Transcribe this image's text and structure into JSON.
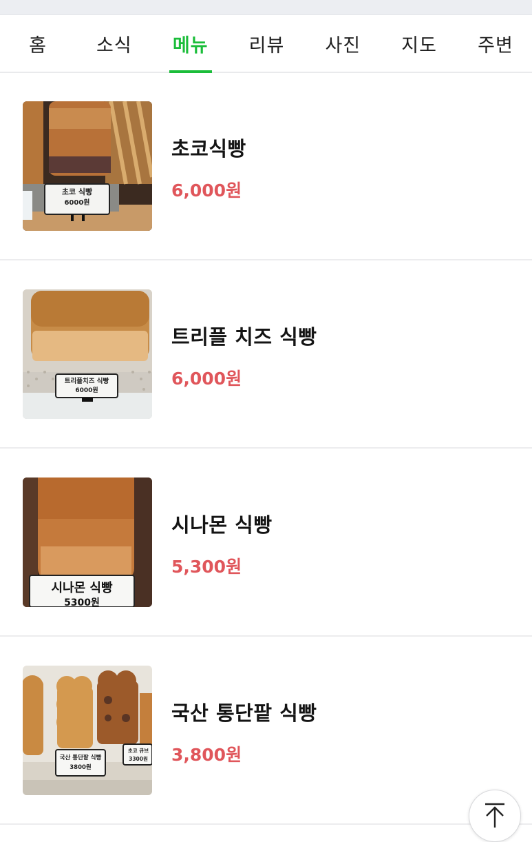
{
  "tabs": [
    {
      "label": "홈"
    },
    {
      "label": "소식"
    },
    {
      "label": "메뉴",
      "active": true
    },
    {
      "label": "리뷰"
    },
    {
      "label": "사진"
    },
    {
      "label": "지도"
    },
    {
      "label": "주변"
    }
  ],
  "menu": [
    {
      "name": "초코식빵",
      "price": "6,000원",
      "photo": {
        "sign_title": "초코 식빵",
        "sign_price": "6000원"
      }
    },
    {
      "name": "트리플 치즈 식빵",
      "price": "6,000원",
      "photo": {
        "sign_title": "트리플치즈 식빵",
        "sign_price": "6000원"
      }
    },
    {
      "name": "시나몬 식빵",
      "price": "5,300원",
      "photo": {
        "sign_title": "시나몬 식빵",
        "sign_price": "5300원"
      }
    },
    {
      "name": "국산 통단팥 식빵",
      "price": "3,800원",
      "photo": {
        "sign_title": "국산 통단팥 식빵",
        "sign_price": "3800원",
        "sign2_title": "초코 큐브",
        "sign2_price": "3300원"
      }
    }
  ],
  "colors": {
    "accent": "#1bbd3a",
    "price": "#e0565b"
  },
  "scroll_top": {
    "icon": "arrow-up-to-top-icon"
  }
}
